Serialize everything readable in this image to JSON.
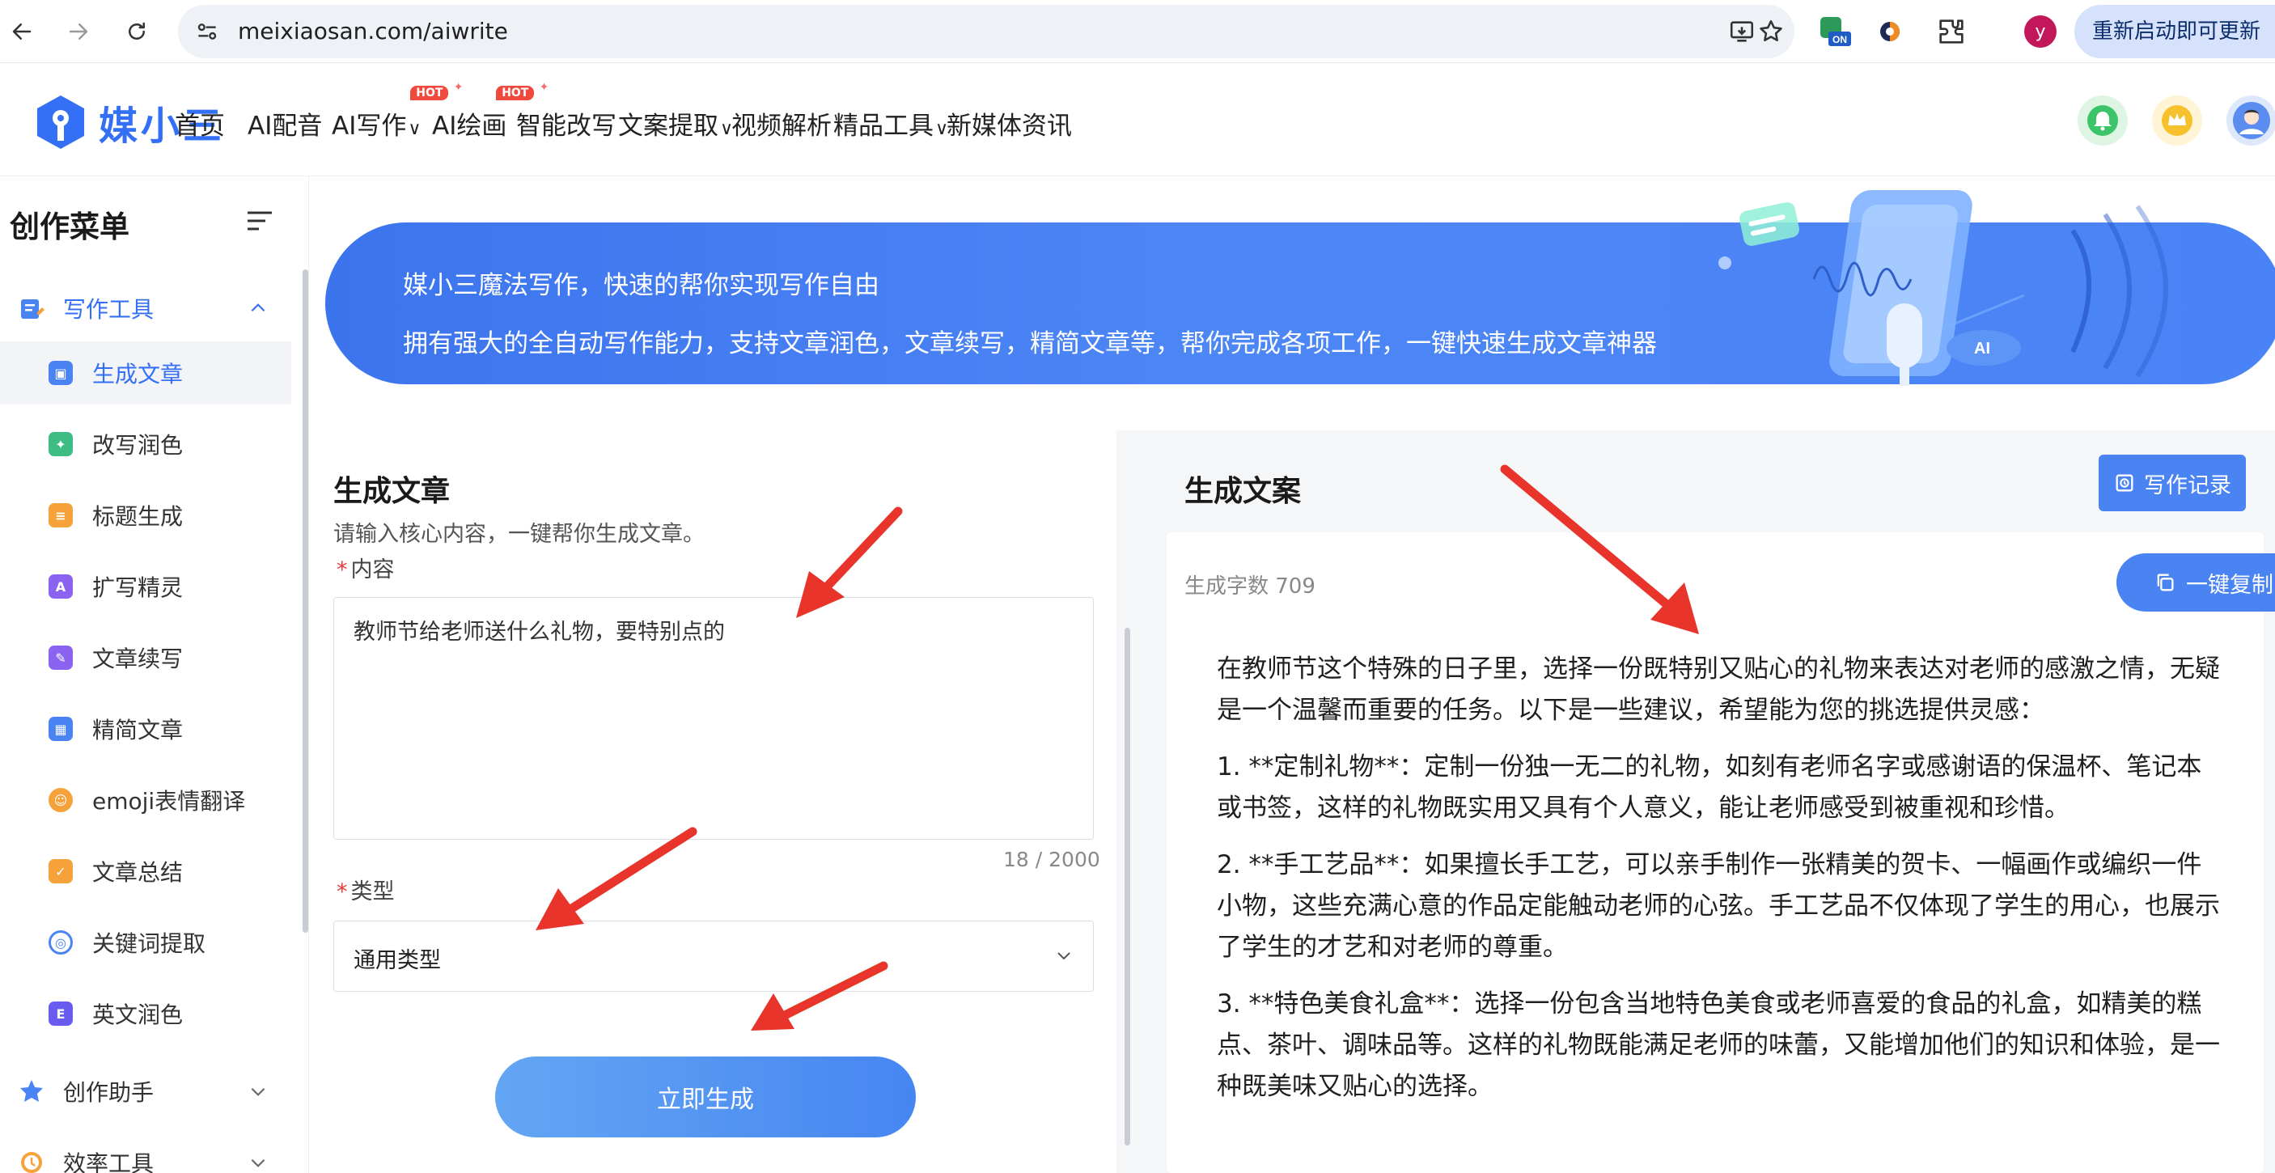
{
  "browser": {
    "url": "meixiaosan.com/aiwrite",
    "profile_initial": "y",
    "update_label": "重新启动即可更新",
    "extension_badge": "ON"
  },
  "header": {
    "logo_text": "媒小三",
    "nav": [
      {
        "label": "首页"
      },
      {
        "label": "AI配音"
      },
      {
        "label": "AI写作",
        "badge": "HOT"
      },
      {
        "label": "AI绘画",
        "badge": "HOT"
      },
      {
        "label": "智能改写"
      },
      {
        "label": "文案提取"
      },
      {
        "label": "视频解析"
      },
      {
        "label": "精品工具"
      },
      {
        "label": "新媒体资讯"
      }
    ],
    "dropdown_chevron": "∨",
    "icons": [
      "bell-icon",
      "crown-icon",
      "user-avatar-icon"
    ]
  },
  "sidebar": {
    "title": "创作菜单",
    "groups": [
      {
        "label": "写作工具",
        "expanded": true
      },
      {
        "label": "创作助手",
        "expanded": false
      },
      {
        "label": "效率工具",
        "expanded": false
      }
    ],
    "items": [
      {
        "label": "生成文章",
        "active": true,
        "color": "#4a83f2"
      },
      {
        "label": "改写润色",
        "color": "#3dbd84"
      },
      {
        "label": "标题生成",
        "color": "#f5a23a"
      },
      {
        "label": "扩写精灵",
        "color": "#8a63f0"
      },
      {
        "label": "文章续写",
        "color": "#8a63f0"
      },
      {
        "label": "精简文章",
        "color": "#4a83f2"
      },
      {
        "label": "emoji表情翻译",
        "color": "#f5a23a"
      },
      {
        "label": "文章总结",
        "color": "#f5a23a"
      },
      {
        "label": "关键词提取",
        "color": "#4a83f2"
      },
      {
        "label": "英文润色",
        "color": "#6b5cf0"
      }
    ]
  },
  "hero": {
    "line1": "媒小三魔法写作，快速的帮你实现写作自由",
    "line2": "拥有强大的全自动写作能力，支持文章润色，文章续写，精简文章等，帮你完成各项工作，一键快速生成文章神器"
  },
  "form": {
    "title": "生成文章",
    "subtitle": "请输入核心内容，一键帮你生成文章。",
    "required_mark": "*",
    "content_label": "内容",
    "content_value": "教师节给老师送什么礼物，要特别点的",
    "char_count": "18 / 2000",
    "type_label": "类型",
    "type_value": "通用类型",
    "submit_label": "立即生成"
  },
  "output": {
    "title": "生成文案",
    "history_label": "写作记录",
    "word_count": "生成字数 709",
    "copy_label": "一键复制",
    "paragraphs": [
      "在教师节这个特殊的日子里，选择一份既特别又贴心的礼物来表达对老师的感激之情，无疑是一个温馨而重要的任务。以下是一些建议，希望能为您的挑选提供灵感：",
      "1. **定制礼物**：定制一份独一无二的礼物，如刻有老师名字或感谢语的保温杯、笔记本或书签，这样的礼物既实用又具有个人意义，能让老师感受到被重视和珍惜。",
      "2. **手工艺品**：如果擅长手工艺，可以亲手制作一张精美的贺卡、一幅画作或编织一件小物，这些充满心意的作品定能触动老师的心弦。手工艺品不仅体现了学生的用心，也展示了学生的才艺和对老师的尊重。",
      "3. **特色美食礼盒**：选择一份包含当地特色美食或老师喜爱的食品的礼盒，如精美的糕点、茶叶、调味品等。这样的礼物既能满足老师的味蕾，又能增加他们的知识和体验，是一种既美味又贴心的选择。"
    ]
  },
  "colors": {
    "primary": "#3470f5",
    "button": "#4a83f2",
    "arrow": "#e8342b",
    "required": "#e83a3a"
  }
}
